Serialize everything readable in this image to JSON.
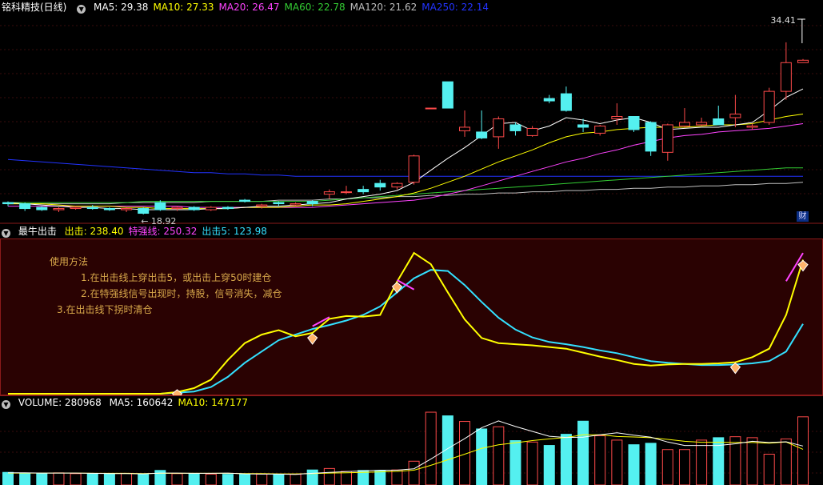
{
  "main": {
    "title": "铭科精技(日线)",
    "ma": [
      {
        "label": "MA5: 29.38",
        "color": "#ffffff"
      },
      {
        "label": "MA10: 27.33",
        "color": "#ffff00"
      },
      {
        "label": "MA20: 26.47",
        "color": "#ff44ff"
      },
      {
        "label": "MA60: 22.78",
        "color": "#33cc33"
      },
      {
        "label": "MA120: 21.62",
        "color": "#bfbfbf"
      },
      {
        "label": "MA250: 22.14",
        "color": "#2233ff"
      }
    ],
    "high_label": "34.41",
    "low_label": "← 18.92",
    "fin_badge": "财"
  },
  "indicator": {
    "title": "最牛出击",
    "fields": [
      {
        "label": "出击: 238.40",
        "color": "#ffff00"
      },
      {
        "label": "特强线: 250.32",
        "color": "#ff44ff"
      },
      {
        "label": "出击5: 123.98",
        "color": "#33e0ff"
      }
    ],
    "notes": [
      "使用方法",
      "1.在出击线上穿出击5，或出击上穿50时建仓",
      "2.在特强线信号出现时，持股，信号消失，减仓",
      "3.在出击线下拐时清仓"
    ]
  },
  "volume": {
    "title": "VOLUME: 280968",
    "ma": [
      {
        "label": "MA5: 160642",
        "color": "#ffffff"
      },
      {
        "label": "MA10: 147177",
        "color": "#ffff00"
      }
    ]
  },
  "chart_data": [
    {
      "type": "candlestick",
      "title": "铭科精技(日线)",
      "x": [
        1,
        2,
        3,
        4,
        5,
        6,
        7,
        8,
        9,
        10,
        11,
        12,
        13,
        14,
        15,
        16,
        17,
        18,
        19,
        20,
        21,
        22,
        23,
        24,
        25,
        26,
        27,
        28,
        29,
        30,
        31,
        32,
        33,
        34,
        35,
        36,
        37,
        38,
        39,
        40,
        41,
        42,
        43,
        44,
        45,
        46,
        47,
        48
      ],
      "ohlc": [
        [
          19.9,
          20.0,
          19.6,
          19.8
        ],
        [
          19.8,
          19.9,
          19.2,
          19.4
        ],
        [
          19.5,
          19.6,
          19.2,
          19.3
        ],
        [
          19.3,
          19.5,
          19.1,
          19.4
        ],
        [
          19.4,
          19.6,
          19.3,
          19.5
        ],
        [
          19.5,
          19.7,
          19.3,
          19.4
        ],
        [
          19.4,
          19.5,
          19.2,
          19.3
        ],
        [
          19.3,
          19.5,
          19.1,
          19.4
        ],
        [
          19.4,
          19.5,
          18.9,
          19.0
        ],
        [
          19.9,
          20.1,
          19.2,
          19.3
        ],
        [
          19.4,
          19.6,
          19.2,
          19.5
        ],
        [
          19.5,
          19.6,
          19.2,
          19.3
        ],
        [
          19.3,
          19.6,
          19.2,
          19.5
        ],
        [
          19.5,
          19.6,
          19.3,
          19.4
        ],
        [
          20.1,
          20.2,
          19.9,
          20.0
        ],
        [
          19.6,
          19.8,
          19.4,
          19.7
        ],
        [
          19.9,
          20.0,
          19.6,
          19.8
        ],
        [
          19.7,
          19.9,
          19.6,
          19.8
        ],
        [
          20.0,
          20.1,
          19.6,
          19.8
        ],
        [
          20.6,
          21.0,
          20.2,
          20.8
        ],
        [
          20.8,
          21.3,
          20.6,
          20.8
        ],
        [
          21.0,
          21.3,
          20.6,
          20.8
        ],
        [
          21.5,
          21.8,
          20.9,
          21.2
        ],
        [
          21.2,
          21.6,
          21.0,
          21.5
        ],
        [
          21.6,
          23.9,
          21.4,
          23.8
        ],
        [
          27.8,
          27.8,
          27.8,
          27.8
        ],
        [
          30.0,
          30.0,
          27.8,
          27.8
        ],
        [
          25.9,
          27.6,
          25.4,
          26.2
        ],
        [
          25.8,
          27.6,
          25.2,
          25.3
        ],
        [
          25.4,
          27.1,
          24.4,
          26.9
        ],
        [
          26.4,
          26.6,
          25.5,
          25.9
        ],
        [
          25.5,
          26.3,
          25.4,
          26.1
        ],
        [
          28.6,
          28.9,
          28.2,
          28.4
        ],
        [
          29.0,
          29.6,
          27.5,
          27.6
        ],
        [
          26.4,
          26.9,
          25.8,
          26.2
        ],
        [
          25.7,
          26.4,
          25.5,
          26.3
        ],
        [
          26.9,
          28.2,
          26.4,
          27.1
        ],
        [
          27.1,
          27.1,
          25.8,
          26.0
        ],
        [
          26.6,
          26.7,
          23.8,
          24.2
        ],
        [
          24.1,
          26.5,
          23.4,
          26.4
        ],
        [
          26.3,
          27.8,
          26.2,
          26.6
        ],
        [
          26.4,
          27.0,
          26.3,
          26.6
        ],
        [
          26.9,
          28.0,
          26.4,
          26.4
        ],
        [
          27.0,
          28.9,
          26.2,
          27.3
        ],
        [
          26.2,
          26.5,
          26.0,
          26.3
        ],
        [
          26.6,
          29.5,
          26.4,
          29.2
        ],
        [
          29.2,
          33.3,
          28.5,
          31.6
        ],
        [
          31.6,
          31.9,
          31.6,
          31.8
        ]
      ],
      "ma": {
        "MA5": [
          19.9,
          19.8,
          19.7,
          19.6,
          19.5,
          19.5,
          19.4,
          19.4,
          19.3,
          19.3,
          19.3,
          19.3,
          19.4,
          19.4,
          19.5,
          19.6,
          19.6,
          19.7,
          19.8,
          19.9,
          20.2,
          20.4,
          20.6,
          20.9,
          21.6,
          22.6,
          23.6,
          24.5,
          25.5,
          26.5,
          26.6,
          25.9,
          26.3,
          27.0,
          26.8,
          26.5,
          26.8,
          27.0,
          26.6,
          26.0,
          26.1,
          26.2,
          26.2,
          26.4,
          26.6,
          27.6,
          28.7,
          29.4
        ],
        "MA10": [
          19.8,
          19.8,
          19.8,
          19.7,
          19.6,
          19.6,
          19.6,
          19.5,
          19.5,
          19.4,
          19.4,
          19.4,
          19.4,
          19.4,
          19.5,
          19.5,
          19.5,
          19.6,
          19.7,
          19.7,
          19.8,
          20.0,
          20.2,
          20.4,
          20.7,
          21.1,
          21.6,
          22.1,
          22.7,
          23.3,
          23.8,
          24.3,
          24.9,
          25.4,
          25.7,
          25.8,
          26.0,
          26.1,
          26.2,
          26.2,
          26.2,
          26.3,
          26.4,
          26.4,
          26.5,
          26.8,
          27.1,
          27.3
        ],
        "MA20": [
          19.6,
          19.6,
          19.6,
          19.6,
          19.6,
          19.6,
          19.6,
          19.6,
          19.6,
          19.6,
          19.6,
          19.5,
          19.5,
          19.5,
          19.5,
          19.5,
          19.5,
          19.5,
          19.5,
          19.6,
          19.7,
          19.8,
          19.9,
          20.0,
          20.1,
          20.3,
          20.6,
          20.9,
          21.3,
          21.7,
          22.1,
          22.5,
          22.9,
          23.3,
          23.6,
          24.0,
          24.3,
          24.7,
          25.0,
          25.3,
          25.5,
          25.6,
          25.8,
          25.9,
          26.0,
          26.1,
          26.3,
          26.5
        ],
        "MA60": [
          19.9,
          19.9,
          19.9,
          19.9,
          19.9,
          19.9,
          19.9,
          19.9,
          20.0,
          20.0,
          20.0,
          20.0,
          20.0,
          20.0,
          20.0,
          20.0,
          20.0,
          20.0,
          20.0,
          20.1,
          20.2,
          20.3,
          20.4,
          20.5,
          20.6,
          20.7,
          20.8,
          20.9,
          21.0,
          21.1,
          21.2,
          21.3,
          21.4,
          21.5,
          21.6,
          21.7,
          21.8,
          21.9,
          22.0,
          22.1,
          22.2,
          22.3,
          22.4,
          22.5,
          22.6,
          22.7,
          22.8,
          22.8
        ],
        "MA120": [
          19.8,
          19.8,
          19.8,
          19.8,
          19.8,
          19.8,
          19.8,
          19.9,
          19.9,
          19.9,
          19.9,
          19.9,
          20.0,
          20.0,
          20.0,
          20.0,
          20.1,
          20.1,
          20.1,
          20.2,
          20.2,
          20.3,
          20.3,
          20.4,
          20.4,
          20.5,
          20.5,
          20.6,
          20.6,
          20.7,
          20.7,
          20.8,
          20.8,
          20.9,
          20.9,
          21.0,
          21.0,
          21.1,
          21.1,
          21.2,
          21.2,
          21.3,
          21.3,
          21.4,
          21.4,
          21.5,
          21.5,
          21.6
        ],
        "MA250": [
          23.5,
          23.4,
          23.3,
          23.2,
          23.1,
          23.0,
          22.9,
          22.8,
          22.7,
          22.6,
          22.5,
          22.4,
          22.4,
          22.3,
          22.3,
          22.2,
          22.2,
          22.1,
          22.1,
          22.1,
          22.1,
          22.1,
          22.1,
          22.1,
          22.1,
          22.1,
          22.1,
          22.1,
          22.1,
          22.1,
          22.1,
          22.1,
          22.1,
          22.1,
          22.1,
          22.1,
          22.1,
          22.1,
          22.1,
          22.1,
          22.1,
          22.1,
          22.1,
          22.1,
          22.1,
          22.1,
          22.1,
          22.1
        ]
      },
      "ylim": [
        18.5,
        35.5
      ]
    },
    {
      "type": "line",
      "title": "最牛出击",
      "series": [
        {
          "name": "出击",
          "values": [
            0,
            0,
            0,
            0,
            0,
            0,
            0,
            0,
            0,
            0,
            3,
            10,
            25,
            60,
            90,
            105,
            113,
            102,
            108,
            133,
            138,
            137,
            140,
            199,
            250,
            230,
            180,
            132,
            99,
            90,
            88,
            86,
            83,
            80,
            73,
            66,
            60,
            53,
            50,
            52,
            53,
            53,
            54,
            56,
            65,
            80,
            140,
            238
          ]
        },
        {
          "name": "特强线",
          "values": [
            null,
            null,
            null,
            null,
            null,
            null,
            null,
            null,
            null,
            null,
            null,
            null,
            null,
            null,
            null,
            null,
            null,
            null,
            120,
            136,
            null,
            null,
            null,
            202,
            185,
            null,
            null,
            null,
            null,
            null,
            null,
            null,
            null,
            null,
            null,
            null,
            null,
            null,
            null,
            null,
            null,
            null,
            null,
            null,
            null,
            null,
            200,
            250
          ]
        },
        {
          "name": "出击5",
          "values": [
            0,
            0,
            0,
            0,
            0,
            0,
            0,
            0,
            0,
            0,
            2,
            4,
            12,
            30,
            55,
            75,
            95,
            105,
            115,
            122,
            130,
            140,
            155,
            180,
            205,
            220,
            218,
            193,
            163,
            135,
            114,
            100,
            92,
            88,
            83,
            77,
            72,
            65,
            58,
            55,
            53,
            51,
            51,
            52,
            54,
            58,
            75,
            124
          ]
        }
      ],
      "ylim": [
        0,
        270
      ]
    },
    {
      "type": "bar",
      "title": "VOLUME",
      "values": [
        52000,
        49000,
        48000,
        50000,
        47000,
        46000,
        46000,
        48000,
        44000,
        60000,
        47000,
        46000,
        45000,
        44000,
        46000,
        45000,
        43000,
        44000,
        62000,
        68000,
        56000,
        60000,
        58000,
        62000,
        98000,
        300000,
        285000,
        262000,
        231000,
        240000,
        183000,
        177000,
        163000,
        209000,
        263000,
        203000,
        185000,
        166000,
        172000,
        146000,
        146000,
        185000,
        195000,
        199000,
        195000,
        127000,
        190000,
        280968
      ],
      "ma": {
        "MA5": [
          50000,
          50000,
          49000,
          49000,
          49000,
          48000,
          47000,
          47000,
          46000,
          49000,
          49000,
          48000,
          48000,
          49000,
          46000,
          45000,
          45000,
          44000,
          48000,
          52000,
          55000,
          58000,
          61000,
          61000,
          67000,
          107000,
          150000,
          191000,
          236000,
          264000,
          241000,
          221000,
          201000,
          196000,
          197000,
          207000,
          215000,
          205000,
          197000,
          177000,
          163000,
          163000,
          163000,
          170000,
          180000,
          175000,
          178000,
          160642
        ],
        "MA10": [
          49000,
          49000,
          49000,
          49000,
          49000,
          48000,
          48000,
          48000,
          47000,
          48000,
          48000,
          48000,
          48000,
          48000,
          47000,
          47000,
          46000,
          46000,
          47000,
          49000,
          50000,
          52000,
          54000,
          56000,
          61000,
          81000,
          104000,
          127000,
          151000,
          166000,
          174000,
          183000,
          190000,
          196000,
          207000,
          207000,
          200000,
          198000,
          195000,
          188000,
          180000,
          176000,
          176000,
          175000,
          175000,
          172000,
          177000,
          147177
        ]
      },
      "ylim": [
        0,
        310000
      ]
    }
  ]
}
